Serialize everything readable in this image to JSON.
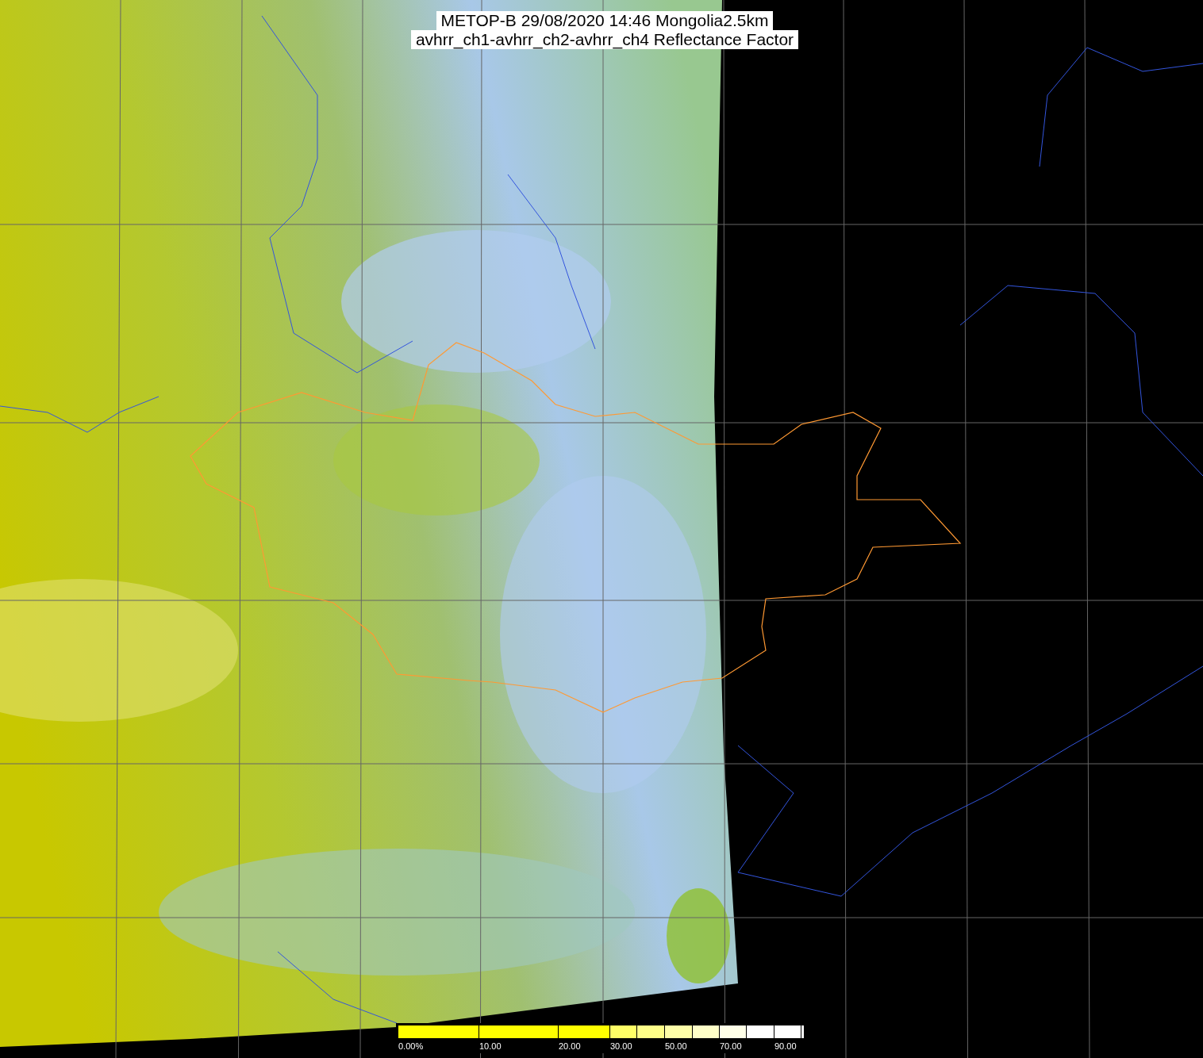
{
  "title": {
    "lines": [
      "METOP-B 29/08/2020 14:46 Mongolia2.5km",
      "avhrr_ch1-avhrr_ch2-avhrr_ch4 Reflectance Factor"
    ]
  },
  "color_scale": {
    "segments": [
      {
        "color": "#ffff00",
        "label": "0.00%"
      },
      {
        "color": "#ffff00",
        "label": "10.00"
      },
      {
        "color": "#ffff00",
        "label": "20.00"
      },
      {
        "color": "#ffff66",
        "label": "30.00"
      },
      {
        "color": "#ffff88"
      },
      {
        "color": "#ffffa8",
        "label": "50.00"
      },
      {
        "color": "#ffffc8"
      },
      {
        "color": "#ffffe8",
        "label": "70.00"
      },
      {
        "color": "#ffffff"
      },
      {
        "color": "#ffffff",
        "label": "90.00"
      },
      {
        "color": "#ffffff"
      }
    ]
  }
}
